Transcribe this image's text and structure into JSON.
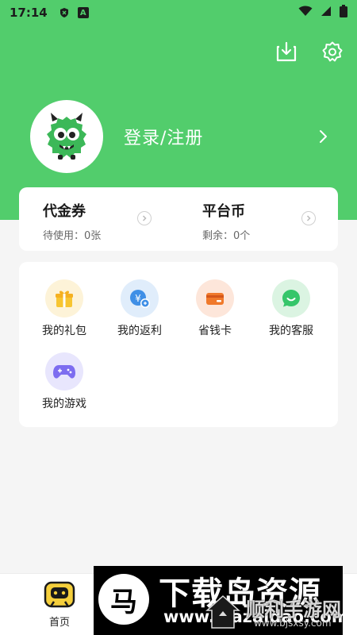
{
  "status_bar": {
    "time": "17:14",
    "notif_a": "A"
  },
  "profile": {
    "login_label": "登录/注册"
  },
  "wallet": {
    "voucher_title": "代金券",
    "voucher_sub": "待使用：0张",
    "coin_title": "平台币",
    "coin_sub": "剩余：0个"
  },
  "services": [
    {
      "label": "我的礼包",
      "icon": "gift-icon",
      "color": "#f7c531"
    },
    {
      "label": "我的返利",
      "icon": "rebate-icon",
      "color": "#3f8fe6"
    },
    {
      "label": "省钱卡",
      "icon": "card-icon",
      "color": "#f0792b"
    },
    {
      "label": "我的客服",
      "icon": "chat-icon",
      "color": "#35c66a"
    },
    {
      "label": "我的游戏",
      "icon": "gamepad-icon",
      "color": "#7d6df0"
    }
  ],
  "tabbar": {
    "home_label": "首页"
  },
  "watermark": {
    "logo_char": "马",
    "big_text": "下载岛资源",
    "small_text": "www.xiazaidao.com",
    "brand_text": "顺利手游网",
    "brand_url": "www.bjsxsy.com"
  },
  "colors": {
    "primary": "#52cd6c",
    "background": "#f5f5f5"
  }
}
